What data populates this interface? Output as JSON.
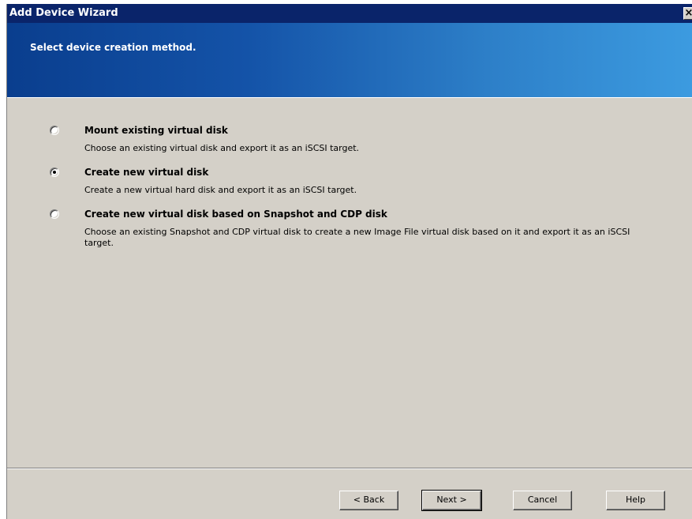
{
  "window": {
    "title": "Add Device Wizard",
    "close_glyph": "×"
  },
  "header": {
    "heading": "Select device creation method."
  },
  "options": [
    {
      "label": "Mount existing virtual disk",
      "description": "Choose an existing virtual disk and export it as an iSCSI target.",
      "selected": false
    },
    {
      "label": "Create new virtual disk",
      "description": "Create a new virtual hard disk and export it as an iSCSI target.",
      "selected": true
    },
    {
      "label": "Create new virtual disk based on Snapshot and CDP disk",
      "description": "Choose an existing Snapshot and CDP virtual disk to create a new Image File virtual disk based on it and export it as an iSCSI target.",
      "selected": false
    }
  ],
  "buttons": {
    "back": "< Back",
    "next": "Next >",
    "cancel": "Cancel",
    "help": "Help"
  }
}
